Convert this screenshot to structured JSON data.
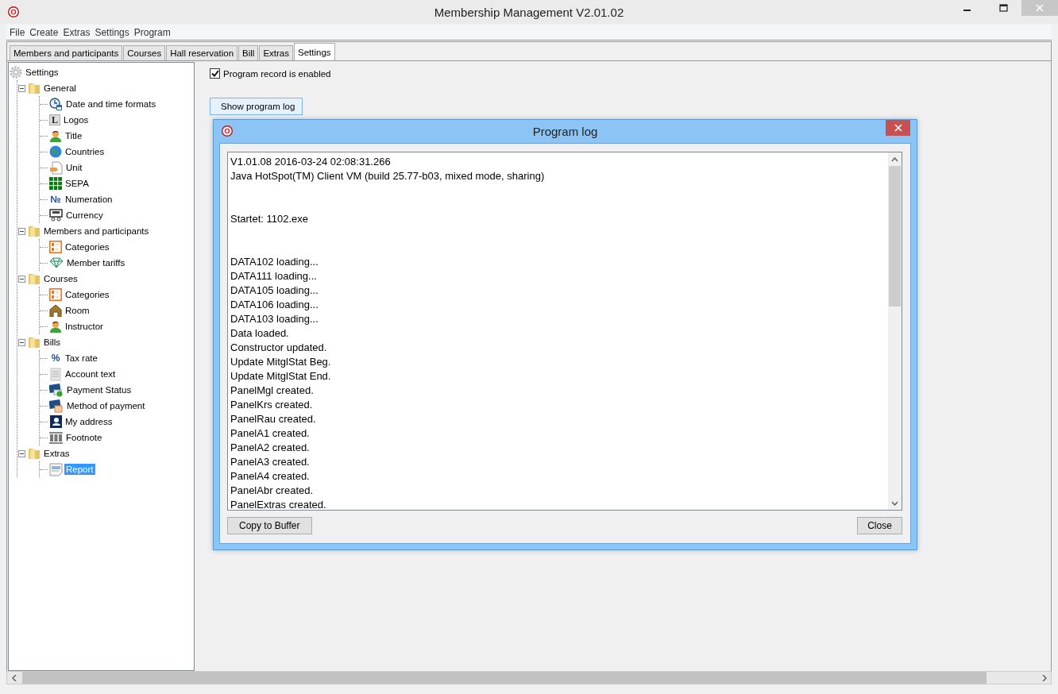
{
  "window": {
    "title": "Membership Management V2.01.02"
  },
  "menu": [
    "File",
    "Create",
    "Extras",
    "Settings",
    "Program"
  ],
  "tabs": [
    {
      "label": "Members and participants",
      "selected": false
    },
    {
      "label": "Courses",
      "selected": false
    },
    {
      "label": "Hall reservation",
      "selected": false
    },
    {
      "label": "Bill",
      "selected": false
    },
    {
      "label": "Extras",
      "selected": false
    },
    {
      "label": "Settings",
      "selected": true
    }
  ],
  "tree": {
    "label": "Settings",
    "children": [
      {
        "label": "General",
        "expanded": true,
        "children": [
          {
            "label": "Date and time formats",
            "selected": false
          },
          {
            "label": "Logos",
            "glyph": "L",
            "selected": false
          },
          {
            "label": "Title",
            "selected": false
          },
          {
            "label": "Countries",
            "selected": false
          },
          {
            "label": "Unit",
            "selected": false
          },
          {
            "label": "SEPA",
            "selected": false
          },
          {
            "label": "Numeration",
            "glyph": "№",
            "selected": false
          },
          {
            "label": "Currency",
            "selected": false
          }
        ]
      },
      {
        "label": "Members and participants",
        "expanded": true,
        "children": [
          {
            "label": "Categories",
            "selected": false
          },
          {
            "label": "Member tariffs",
            "selected": false
          }
        ]
      },
      {
        "label": "Courses",
        "expanded": true,
        "children": [
          {
            "label": "Categories",
            "selected": false
          },
          {
            "label": "Room",
            "selected": false
          },
          {
            "label": "Instructor",
            "selected": false
          }
        ]
      },
      {
        "label": "Bills",
        "expanded": true,
        "children": [
          {
            "label": "Tax rate",
            "glyph": "%",
            "selected": false
          },
          {
            "label": "Account text",
            "selected": false
          },
          {
            "label": "Payment Status",
            "selected": false
          },
          {
            "label": "Method of payment",
            "selected": false
          },
          {
            "label": "My address",
            "selected": false
          },
          {
            "label": "Footnote",
            "selected": false
          }
        ]
      },
      {
        "label": "Extras",
        "expanded": true,
        "children": [
          {
            "label": "Report",
            "selected": true
          }
        ]
      }
    ]
  },
  "settings": {
    "program_record": {
      "label": "Program record is enabled",
      "checked": true
    },
    "show_log_button": "Show program log"
  },
  "dialog": {
    "title": "Program log",
    "log_blocks": [
      [
        "V1.01.08 2016-03-24 02:08:31.266",
        "Java HotSpot(TM) Client VM (build 25.77-b03, mixed mode, sharing)"
      ],
      [
        "Startet: 1102.exe"
      ],
      [
        "DATA102 loading...",
        "DATA111 loading...",
        "DATA105 loading...",
        "DATA106 loading...",
        "DATA103 loading...",
        "Data loaded.",
        "Constructor updated.",
        "Update MitglStat Beg.",
        "Update MitglStat End.",
        "PanelMgl created.",
        "PanelKrs created.",
        "PanelRau created.",
        "PanelA1 created.",
        "PanelA2 created.",
        "PanelA3 created.",
        "PanelA4 created.",
        "PanelAbr created.",
        "PanelExtras created."
      ]
    ],
    "buttons": [
      "Copy to Buffer",
      "Close"
    ]
  }
}
